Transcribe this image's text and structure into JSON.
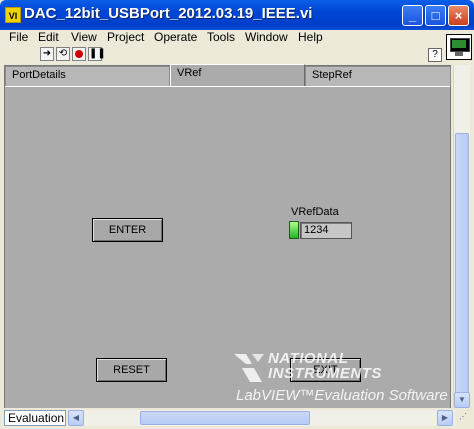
{
  "window": {
    "title": "DAC_12bit_USBPort_2012.03.19_IEEE.vi",
    "app_icon": "labview-vi-icon",
    "minimize": "_",
    "maximize": "□",
    "close": "×"
  },
  "menu": {
    "items": [
      "File",
      "Edit",
      "View",
      "Project",
      "Operate",
      "Tools",
      "Window",
      "Help"
    ]
  },
  "toolbar": {
    "icons": [
      "run-arrow-icon",
      "run-continuously-icon",
      "abort-icon",
      "pause-icon"
    ],
    "help_icon": "?"
  },
  "tabs": [
    {
      "label": "PortDetails",
      "active": false
    },
    {
      "label": "VRef",
      "active": true
    },
    {
      "label": "StepRef",
      "active": false
    }
  ],
  "controls": {
    "enter_label": "ENTER",
    "reset_label": "RESET",
    "exit_label": "EXIT",
    "vrefdata_label": "VRefData",
    "vrefdata_value": "1234",
    "led_color": "#22b422"
  },
  "watermark": {
    "line1": "NATIONAL",
    "line2": "INSTRUMENTS",
    "line3": "LabVIEW™Evaluation Software"
  },
  "status": {
    "mode": "Evaluation"
  }
}
